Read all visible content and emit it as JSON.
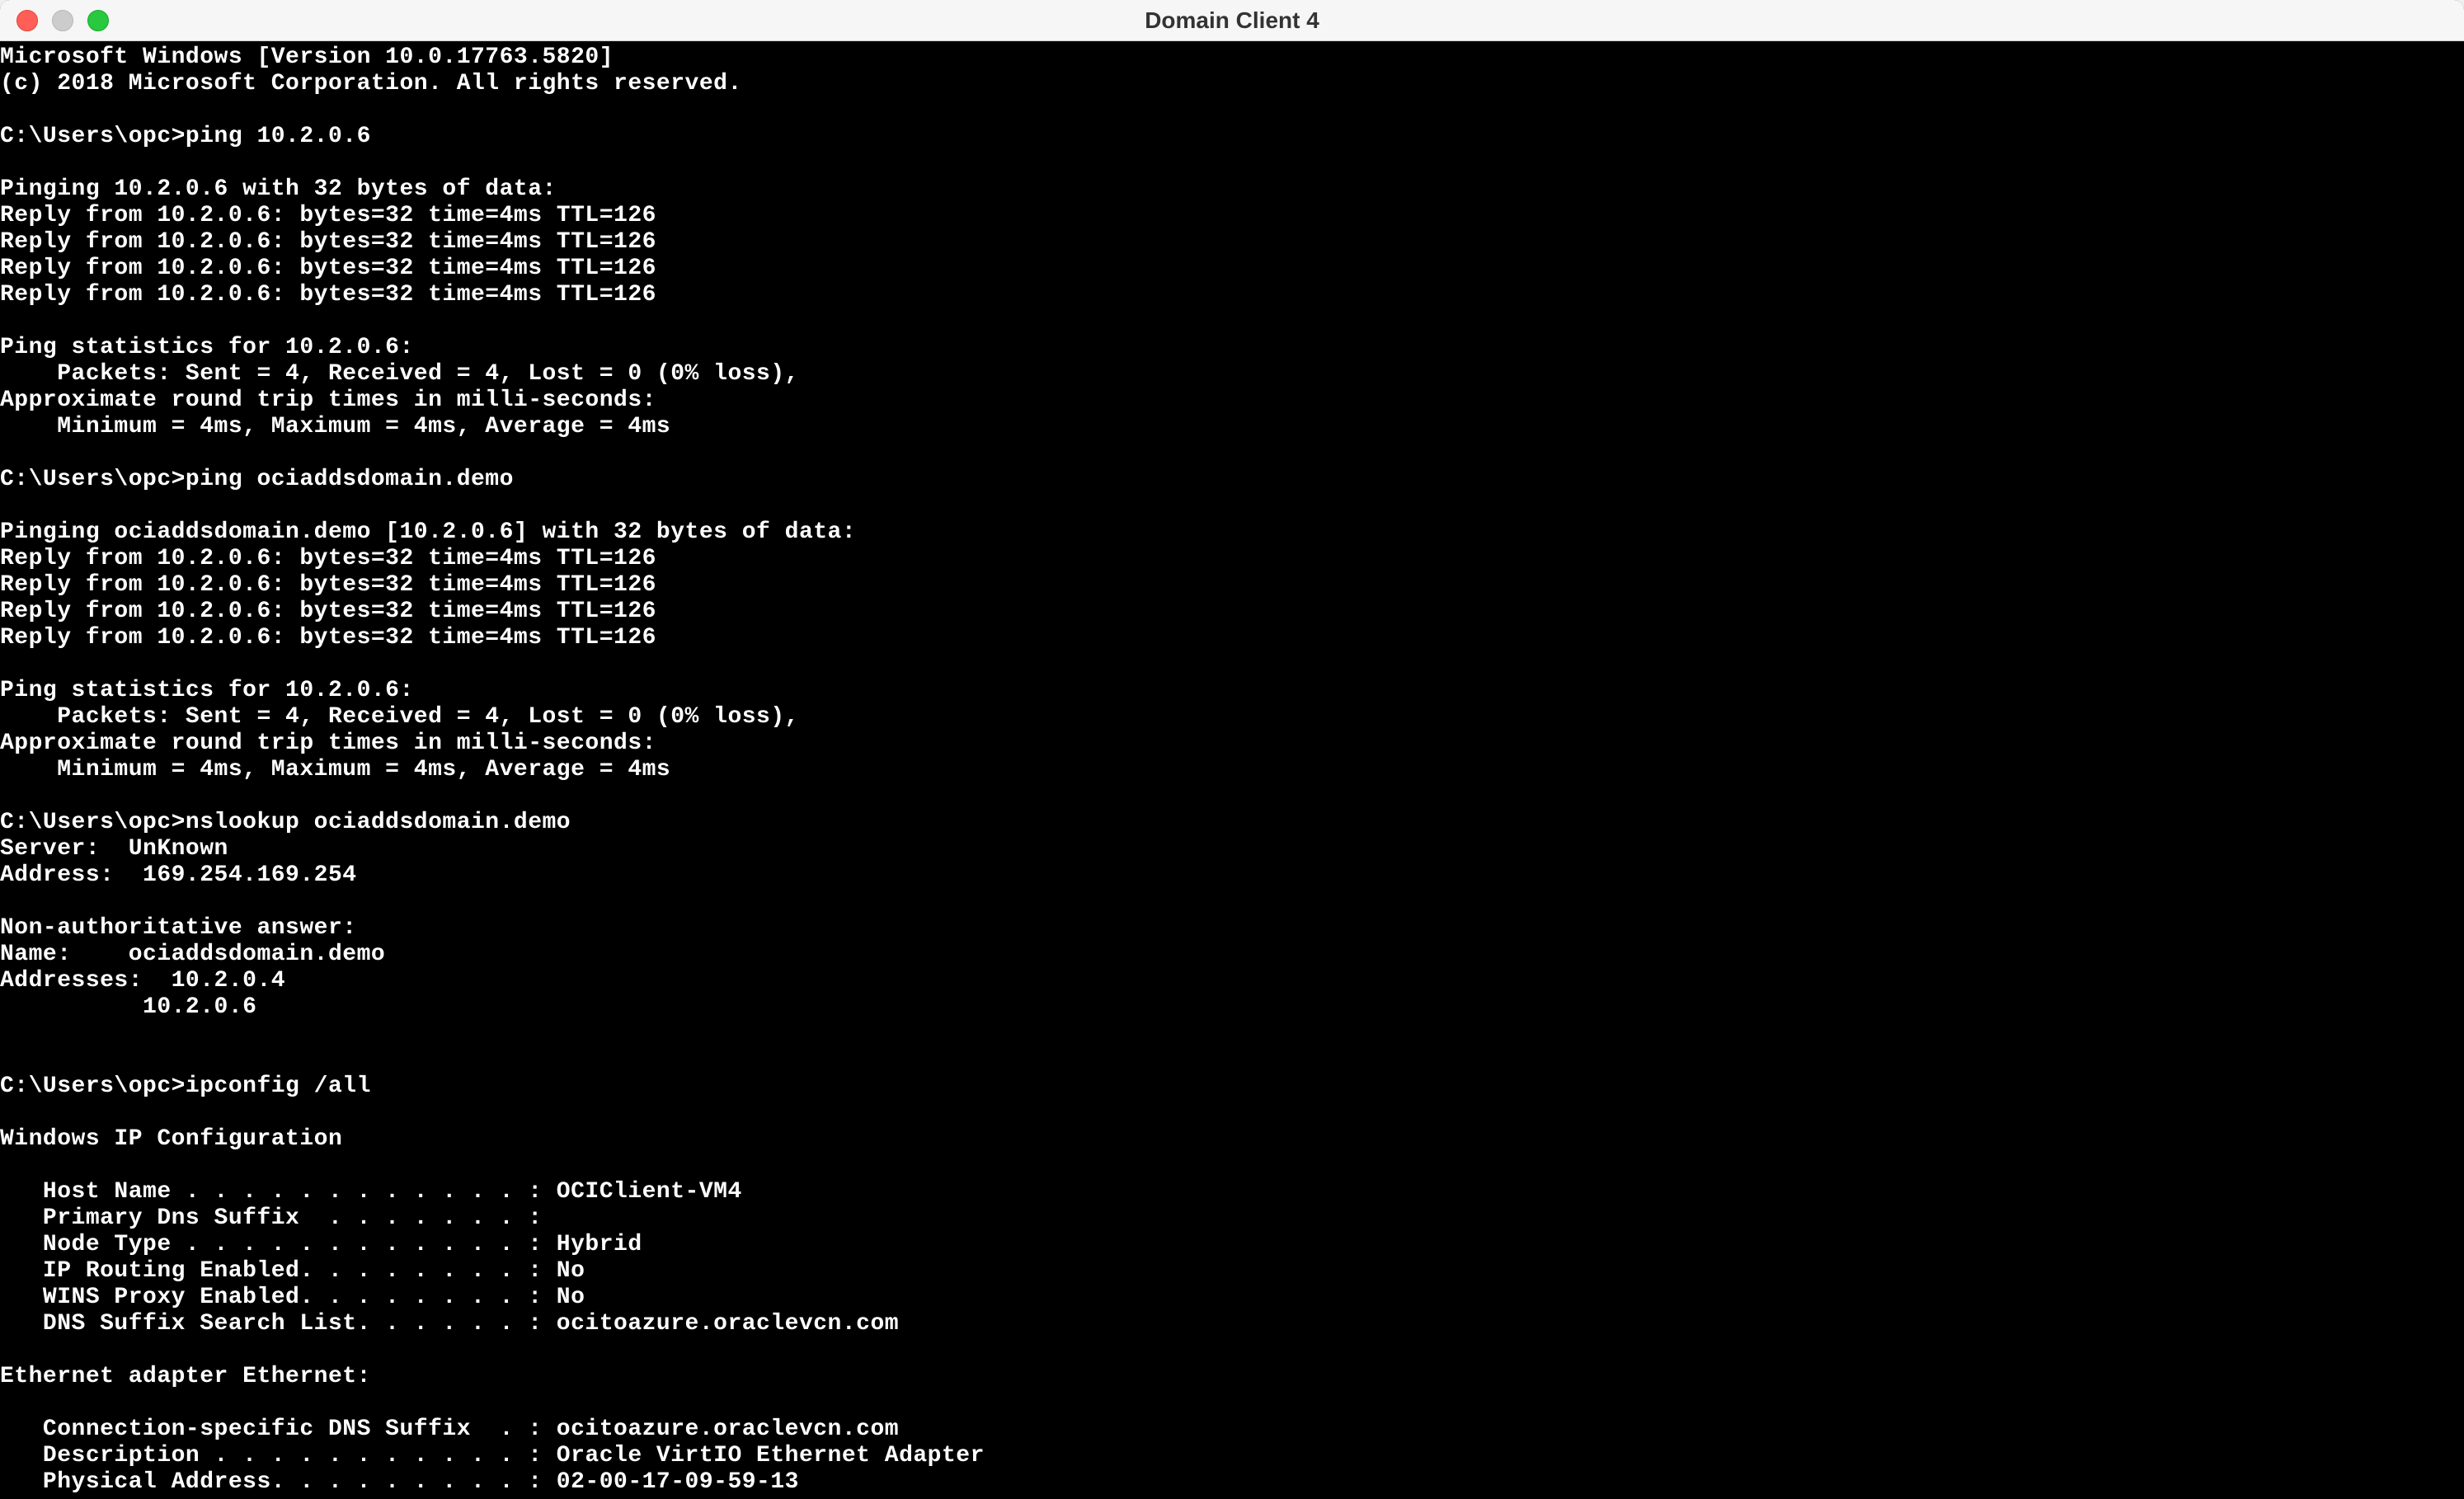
{
  "window": {
    "title": "Domain Client 4"
  },
  "terminal": {
    "lines": [
      "Microsoft Windows [Version 10.0.17763.5820]",
      "(c) 2018 Microsoft Corporation. All rights reserved.",
      "",
      "C:\\Users\\opc>ping 10.2.0.6",
      "",
      "Pinging 10.2.0.6 with 32 bytes of data:",
      "Reply from 10.2.0.6: bytes=32 time=4ms TTL=126",
      "Reply from 10.2.0.6: bytes=32 time=4ms TTL=126",
      "Reply from 10.2.0.6: bytes=32 time=4ms TTL=126",
      "Reply from 10.2.0.6: bytes=32 time=4ms TTL=126",
      "",
      "Ping statistics for 10.2.0.6:",
      "    Packets: Sent = 4, Received = 4, Lost = 0 (0% loss),",
      "Approximate round trip times in milli-seconds:",
      "    Minimum = 4ms, Maximum = 4ms, Average = 4ms",
      "",
      "C:\\Users\\opc>ping ociaddsdomain.demo",
      "",
      "Pinging ociaddsdomain.demo [10.2.0.6] with 32 bytes of data:",
      "Reply from 10.2.0.6: bytes=32 time=4ms TTL=126",
      "Reply from 10.2.0.6: bytes=32 time=4ms TTL=126",
      "Reply from 10.2.0.6: bytes=32 time=4ms TTL=126",
      "Reply from 10.2.0.6: bytes=32 time=4ms TTL=126",
      "",
      "Ping statistics for 10.2.0.6:",
      "    Packets: Sent = 4, Received = 4, Lost = 0 (0% loss),",
      "Approximate round trip times in milli-seconds:",
      "    Minimum = 4ms, Maximum = 4ms, Average = 4ms",
      "",
      "C:\\Users\\opc>nslookup ociaddsdomain.demo",
      "Server:  UnKnown",
      "Address:  169.254.169.254",
      "",
      "Non-authoritative answer:",
      "Name:    ociaddsdomain.demo",
      "Addresses:  10.2.0.4",
      "          10.2.0.6",
      "",
      "",
      "C:\\Users\\opc>ipconfig /all",
      "",
      "Windows IP Configuration",
      "",
      "   Host Name . . . . . . . . . . . . : OCIClient-VM4",
      "   Primary Dns Suffix  . . . . . . . :",
      "   Node Type . . . . . . . . . . . . : Hybrid",
      "   IP Routing Enabled. . . . . . . . : No",
      "   WINS Proxy Enabled. . . . . . . . : No",
      "   DNS Suffix Search List. . . . . . : ocitoazure.oraclevcn.com",
      "",
      "Ethernet adapter Ethernet:",
      "",
      "   Connection-specific DNS Suffix  . : ocitoazure.oraclevcn.com",
      "   Description . . . . . . . . . . . : Oracle VirtIO Ethernet Adapter",
      "   Physical Address. . . . . . . . . : 02-00-17-09-59-13"
    ]
  }
}
